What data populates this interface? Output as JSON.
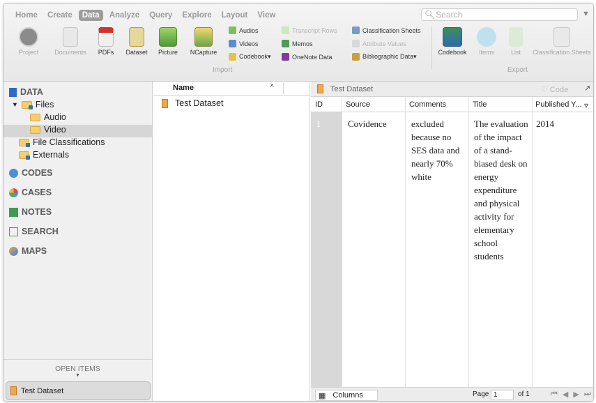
{
  "menu": {
    "tabs": [
      {
        "label": "Home",
        "active": false
      },
      {
        "label": "Create",
        "active": false
      },
      {
        "label": "Data",
        "active": true
      },
      {
        "label": "Analyze",
        "active": false
      },
      {
        "label": "Query",
        "active": false
      },
      {
        "label": "Explore",
        "active": false
      },
      {
        "label": "Layout",
        "active": false
      },
      {
        "label": "View",
        "active": false
      }
    ],
    "search_placeholder": "Search"
  },
  "ribbon": {
    "project": "Project",
    "documents": "Documents",
    "pdfs": "PDFs",
    "dataset": "Dataset",
    "picture": "Picture",
    "ncapture": "NCapture",
    "audios": "Audios",
    "videos": "Videos",
    "codebook_import": "Codebook▾",
    "transcript_rows": "Transcript Rows",
    "memos": "Memos",
    "onenote": "OneNote Data",
    "classification_sheets_import": "Classification Sheets",
    "attribute_values": "Attribute Values",
    "bibliographic": "Bibliographic Data▾",
    "import_group": "Import",
    "codebook_export": "Codebook",
    "items": "Items",
    "list": "List",
    "classification_sheets_export": "Classification Sheets",
    "export_group": "Export"
  },
  "sidebar": {
    "data_header": "DATA",
    "files": "Files",
    "audio": "Audio",
    "video": "Video",
    "file_classifications": "File Classifications",
    "externals": "Externals",
    "codes": "CODES",
    "cases": "CASES",
    "notes": "NOTES",
    "search": "SEARCH",
    "maps": "MAPS",
    "open_items_header": "OPEN ITEMS",
    "open_item": "Test Dataset"
  },
  "list": {
    "header_name": "Name",
    "rows": [
      {
        "name": "Test Dataset"
      }
    ]
  },
  "detail": {
    "title": "Test Dataset",
    "code_button": "Code",
    "columns": [
      "ID",
      "Source",
      "Comments",
      "Title",
      "Published Y..."
    ],
    "rows": [
      {
        "id": "1",
        "source": "Covidence",
        "comments_lines": [
          "excluded",
          "because no",
          "SES data and",
          "nearly 70%",
          "white"
        ],
        "title_lines": [
          "The evaluation",
          "of the impact",
          "of a stand-",
          "biased desk on",
          "energy",
          "expenditure",
          "and physical",
          "activity for",
          "elementary",
          "school",
          "students"
        ],
        "published": "2014"
      }
    ],
    "footer": {
      "columns_button": "Columns",
      "page_label": "Page",
      "page_value": "1",
      "page_of": "of 1"
    }
  },
  "colors": {
    "selected_tab": "#9d9d9d",
    "sidebar_bg": "#f0f0f0",
    "selection": "#d6d6d6",
    "id_column": "#d8d8d8"
  }
}
